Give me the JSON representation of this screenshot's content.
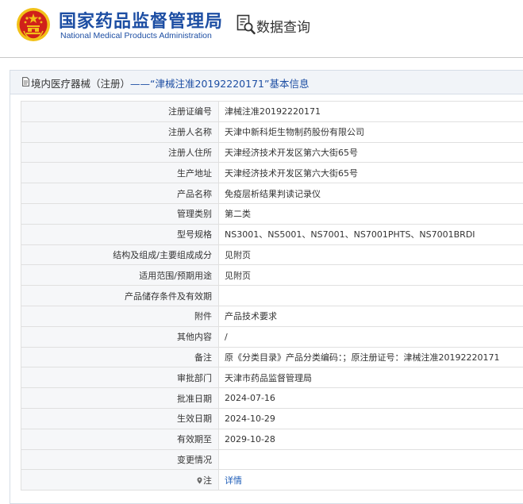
{
  "header": {
    "logo_cn": "国家药品监督管理局",
    "logo_en": "National Medical Products Administration",
    "query_label": "数据查询",
    "icons": {
      "emblem": "national-emblem-icon",
      "query": "document-search-icon"
    }
  },
  "panel": {
    "title_prefix": "境内医疗器械（注册）",
    "title_main": "——“津械注准20192220171”基本信息",
    "icon": "document-icon"
  },
  "rows": [
    {
      "label": "注册证编号",
      "value": "津械注准20192220171"
    },
    {
      "label": "注册人名称",
      "value": "天津中新科炬生物制药股份有限公司"
    },
    {
      "label": "注册人住所",
      "value": "天津经济技术开发区第六大街65号"
    },
    {
      "label": "生产地址",
      "value": "天津经济技术开发区第六大街65号"
    },
    {
      "label": "产品名称",
      "value": "免疫层析结果判读记录仪"
    },
    {
      "label": "管理类别",
      "value": "第二类"
    },
    {
      "label": "型号规格",
      "value": "NS3001、NS5001、NS7001、NS7001PHTS、NS7001BRDI"
    },
    {
      "label": "结构及组成/主要组成成分",
      "value": "见附页"
    },
    {
      "label": "适用范围/预期用途",
      "value": "见附页"
    },
    {
      "label": "产品储存条件及有效期",
      "value": ""
    },
    {
      "label": "附件",
      "value": "产品技术要求"
    },
    {
      "label": "其他内容",
      "value": "/"
    },
    {
      "label": "备注",
      "value": "原《分类目录》产品分类编码：；原注册证号：津械注准20192220171"
    },
    {
      "label": "审批部门",
      "value": "天津市药品监督管理局"
    },
    {
      "label": "批准日期",
      "value": "2024-07-16"
    },
    {
      "label": "生效日期",
      "value": "2024-10-29"
    },
    {
      "label": "有效期至",
      "value": "2029-10-28"
    },
    {
      "label": "变更情况",
      "value": ""
    },
    {
      "label": "注",
      "value": "详情",
      "icon": "pin-icon"
    }
  ],
  "colors": {
    "brand_blue": "#1d4ea3",
    "emblem_red": "#d0201a",
    "emblem_gold": "#f2c118",
    "link_blue": "#1d5cb8"
  }
}
